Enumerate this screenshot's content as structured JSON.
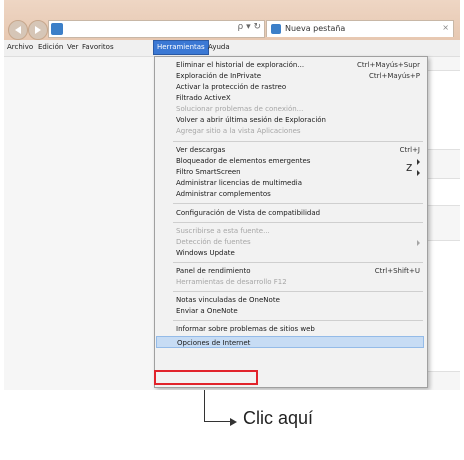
{
  "browser": {
    "address_controls": "ρ ▾ ↻",
    "tab_title": "Nueva pestaña",
    "tab_close": "×"
  },
  "menubar": {
    "items": [
      "Archivo",
      "Edición",
      "Ver",
      "Favoritos",
      "Herramientas",
      "Ayuda"
    ],
    "active_index": 4
  },
  "tools_menu": {
    "items": [
      {
        "label": "Eliminar el historial de exploración...",
        "shortcut": "Ctrl+Mayús+Supr"
      },
      {
        "label": "Exploración de InPrivate",
        "shortcut": "Ctrl+Mayús+P"
      },
      {
        "label": "Activar la protección de rastreo",
        "shortcut": ""
      },
      {
        "label": "Filtrado ActiveX",
        "shortcut": ""
      },
      {
        "label": "Solucionar problemas de conexión...",
        "shortcut": "",
        "disabled": true
      },
      {
        "label": "Volver a abrir última sesión de Exploración",
        "shortcut": ""
      },
      {
        "label": "Agregar sitio a la vista Aplicaciones",
        "shortcut": "",
        "disabled": true
      },
      {
        "label": "Ver descargas",
        "shortcut": "Ctrl+J"
      },
      {
        "label": "Bloqueador de elementos emergentes",
        "shortcut": "",
        "submenu": true
      },
      {
        "label": "Filtro SmartScreen",
        "shortcut": "",
        "submenu": true
      },
      {
        "label": "Administrar licencias de multimedia",
        "shortcut": ""
      },
      {
        "label": "Administrar complementos",
        "shortcut": ""
      },
      {
        "label": "Configuración de Vista de compatibilidad",
        "shortcut": ""
      },
      {
        "label": "Suscribirse a esta fuente...",
        "shortcut": "",
        "disabled": true
      },
      {
        "label": "Detección de fuentes",
        "shortcut": "",
        "disabled": true,
        "submenu": true
      },
      {
        "label": "Windows Update",
        "shortcut": ""
      },
      {
        "label": "Panel de rendimiento",
        "shortcut": "Ctrl+Shift+U"
      },
      {
        "label": "Herramientas de desarrollo F12",
        "shortcut": "",
        "disabled": true
      },
      {
        "label": "Notas vinculadas de OneNote",
        "shortcut": ""
      },
      {
        "label": "Enviar a OneNote",
        "shortcut": ""
      },
      {
        "label": "Informar sobre problemas de sitios web",
        "shortcut": ""
      },
      {
        "label": "Opciones de Internet",
        "shortcut": "",
        "highlight": true
      }
    ]
  },
  "annotation": {
    "text": "Clic aquí"
  },
  "colors": {
    "menu_highlight": "#3b78d4",
    "callout_red": "#e1232b"
  }
}
